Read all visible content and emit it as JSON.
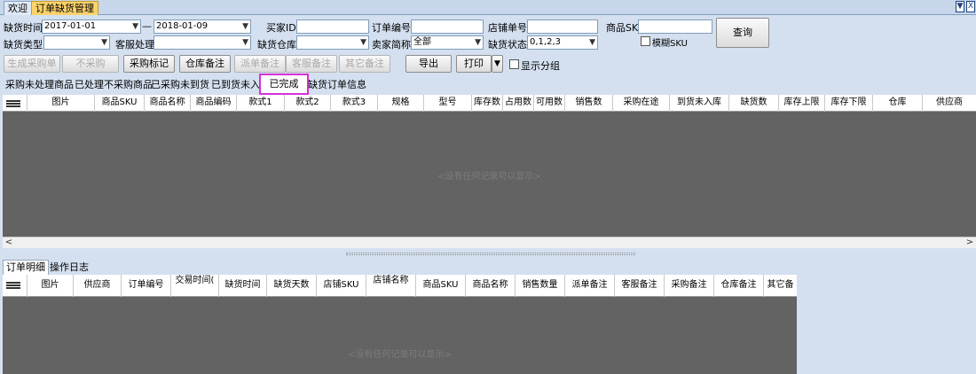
{
  "tabs": {
    "welcome": "欢迎",
    "order_shortage": "订单缺货管理"
  },
  "filters": {
    "shortage_time_label": "缺货时间",
    "date_from": "2017-01-01",
    "date_sep": "—",
    "date_to": "2018-01-09",
    "buyer_id_label": "买家ID",
    "order_no_label": "订单编号",
    "shop_order_no_label": "店铺单号",
    "sku_label": "商品SKU",
    "shortage_type_label": "缺货类型",
    "cs_process_label": "客服处理",
    "warehouse_label": "缺货仓库",
    "buyer_short_label": "卖家简称",
    "buyer_short_value": "全部",
    "status_label": "缺货状态",
    "status_value": "0,1,2,3",
    "fuzzy_sku_label": "模糊SKU",
    "query_button": "查询"
  },
  "toolbar": {
    "gen_purchase": "生成采购单",
    "no_purchase": "不采购",
    "purchase_mark": "采购标记",
    "warehouse_note": "仓库备注",
    "dispatch_note": "派单备注",
    "cs_note": "客服备注",
    "other_note": "其它备注",
    "export": "导出",
    "print": "打印",
    "show_group": "显示分组"
  },
  "subtabs": [
    "采购未处理商品",
    "已处理不采购商品",
    "已采购未到货",
    "已到货未入库",
    "已完成",
    "缺货订单信息"
  ],
  "grid1": {
    "columns": [
      "图片",
      "商品SKU",
      "商品名称",
      "商品编码",
      "款式1",
      "款式2",
      "款式3",
      "规格",
      "型号",
      "库存数",
      "占用数",
      "可用数",
      "销售数",
      "采购在途",
      "到货未入库",
      "缺货数",
      "库存上限",
      "库存下限",
      "仓库",
      "供应商"
    ],
    "empty": "<没有任何记录可以显示>"
  },
  "bottom_tabs": [
    "订单明细",
    "操作日志"
  ],
  "grid2": {
    "columns": [
      "图片",
      "供应商",
      "订单编号",
      "交易时间(",
      "缺货时间",
      "缺货天数",
      "店铺SKU",
      "店铺名称",
      "商品SKU",
      "商品名称",
      "销售数量",
      "派单备注",
      "客服备注",
      "采购备注",
      "仓库备注",
      "其它备"
    ],
    "empty": "<没有任何记录可以显示>"
  },
  "icons": {
    "dropdown": "▼",
    "scroll_left": "<",
    "scroll_right": ">",
    "window_restore": "▼",
    "window_close": "X"
  },
  "colors": {
    "highlight": "#d633d6",
    "active_tab": "#ffd36b",
    "grid_bg": "#636363"
  }
}
